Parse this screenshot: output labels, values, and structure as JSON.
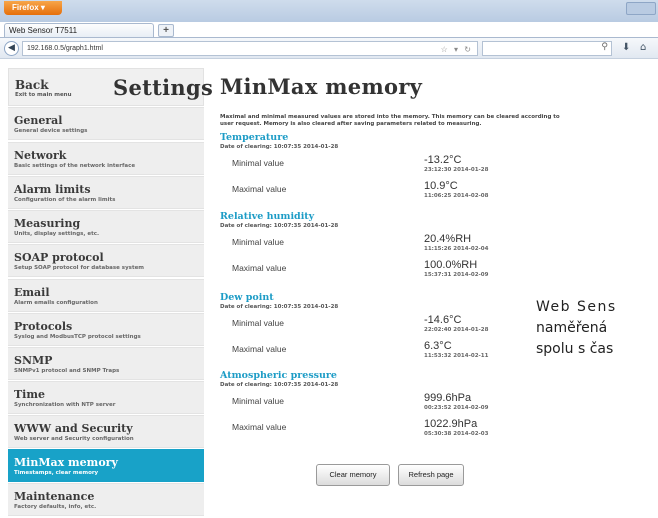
{
  "browser": {
    "app_button": "Firefox",
    "tab_title": "Web Sensor T7511",
    "new_tab": "+",
    "url": "192.168.0.5/graph1.html"
  },
  "sidebar": {
    "back_label": "Back",
    "back_sub": "Exit to main menu",
    "title": "Settings",
    "items": [
      {
        "label": "General",
        "sub": "General device settings"
      },
      {
        "label": "Network",
        "sub": "Basic settings of the network interface"
      },
      {
        "label": "Alarm limits",
        "sub": "Configuration of the alarm limits"
      },
      {
        "label": "Measuring",
        "sub": "Units, display settings, etc."
      },
      {
        "label": "SOAP protocol",
        "sub": "Setup SOAP protocol for database system"
      },
      {
        "label": "Email",
        "sub": "Alarm emails configuration"
      },
      {
        "label": "Protocols",
        "sub": "Syslog and ModbusTCP protocol settings"
      },
      {
        "label": "SNMP",
        "sub": "SNMPv1 protocol and SNMP Traps"
      },
      {
        "label": "Time",
        "sub": "Synchronization with NTP server"
      },
      {
        "label": "WWW and Security",
        "sub": "Web server and Security configuration"
      },
      {
        "label": "MinMax memory",
        "sub": "Timestamps, clear memory"
      },
      {
        "label": "Maintenance",
        "sub": "Factory defaults, info, etc."
      }
    ],
    "active_index": 10
  },
  "main": {
    "title": "MinMax memory",
    "intro": "Maximal and minimal measured values are stored into the memory. This memory can be cleared according to user request. Memory is also cleared after saving parameters related to measuring.",
    "min_label": "Minimal value",
    "max_label": "Maximal value",
    "sections": [
      {
        "title": "Temperature",
        "date": "Date of clearing: 10:07:35 2014-01-28",
        "min": "-13.2°C",
        "min_ts": "23:12:30 2014-01-28",
        "max": "10.9°C",
        "max_ts": "11:06:25 2014-02-08"
      },
      {
        "title": "Relative humidity",
        "date": "Date of clearing: 10:07:35 2014-01-28",
        "min": "20.4%RH",
        "min_ts": "11:15:26 2014-02-04",
        "max": "100.0%RH",
        "max_ts": "15:37:31 2014-02-09"
      },
      {
        "title": "Dew point",
        "date": "Date of clearing: 10:07:35 2014-01-28",
        "min": "-14.6°C",
        "min_ts": "22:02:40 2014-01-28",
        "max": "6.3°C",
        "max_ts": "11:53:32 2014-02-11"
      },
      {
        "title": "Atmospheric pressure",
        "date": "Date of clearing: 10:07:35 2014-01-28",
        "min": "999.6hPa",
        "min_ts": "00:23:52 2014-02-09",
        "max": "1022.9hPa",
        "max_ts": "05:30:38 2014-02-03"
      }
    ],
    "clear_button": "Clear memory",
    "refresh_button": "Refresh page"
  },
  "overlay_text": {
    "line1": "Web Sens",
    "line2": "naměřená",
    "line3": "spolu s čas"
  },
  "colors": {
    "accent": "#18a2c8",
    "section_title": "#1d9cc6"
  }
}
